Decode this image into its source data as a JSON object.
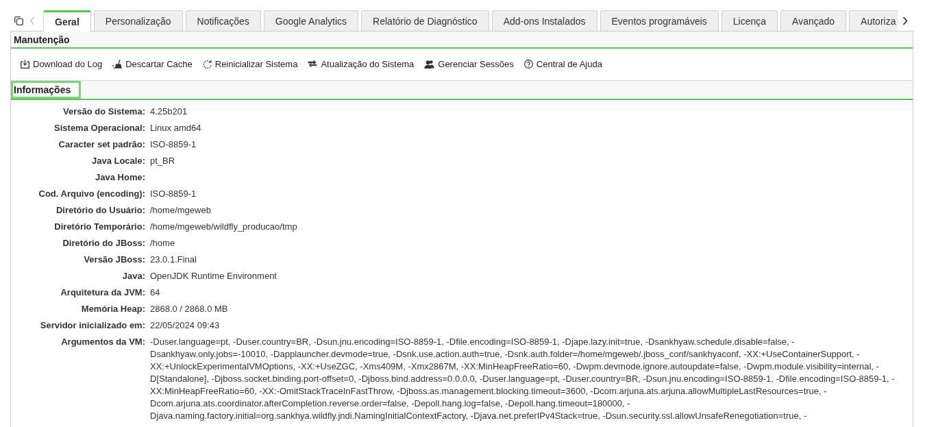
{
  "tab_scroll_buttons": [
    {
      "kind": "previous",
      "disabled": true
    },
    {
      "kind": "next",
      "disabled": false
    }
  ],
  "tabs": [
    {
      "label": "Geral",
      "selected": true
    },
    {
      "label": "Personalização",
      "selected": false
    },
    {
      "label": "Notificações",
      "selected": false
    },
    {
      "label": "Google Analytics",
      "selected": false
    },
    {
      "label": "Relatório de Diagnóstico",
      "selected": false
    },
    {
      "label": "Add-ons Instalados",
      "selected": false
    },
    {
      "label": "Eventos programáveis",
      "selected": false
    },
    {
      "label": "Licença",
      "selected": false
    },
    {
      "label": "Avançado",
      "selected": false
    },
    {
      "label": "Autoriza",
      "selected": false
    }
  ],
  "maintenance": {
    "title": "Manutenção",
    "focused": false,
    "actions": [
      {
        "kind": "download",
        "label": "Download do Log"
      },
      {
        "kind": "broom",
        "label": "Descartar Cache"
      },
      {
        "kind": "restart",
        "label": "Reinicializar Sistema"
      },
      {
        "kind": "swap",
        "label": "Atualização do Sistema"
      },
      {
        "kind": "people",
        "label": "Gerenciar Sessões"
      },
      {
        "kind": "help",
        "label": "Central de Ajuda"
      }
    ]
  },
  "information": {
    "title": "Informações",
    "focused": true,
    "rows": [
      {
        "label": "Versão do Sistema:",
        "value": "4.25b201"
      },
      {
        "label": "Sistema Operacional:",
        "value": "Linux amd64"
      },
      {
        "label": "Caracter set padrão:",
        "value": "ISO-8859-1"
      },
      {
        "label": "Java Locale:",
        "value": "pt_BR"
      },
      {
        "label": "Java Home:"
      },
      {
        "label": "Cod. Arquivo (encoding):",
        "value": "ISO-8859-1"
      },
      {
        "label": "Diretório do Usuário:",
        "value": "/home/mgeweb"
      },
      {
        "label": "Diretório Temporário:",
        "value": "/home/mgeweb/wildfly_producao/tmp"
      },
      {
        "label": "Diretório do JBoss:",
        "value": "/home"
      },
      {
        "label": "Versão JBoss:",
        "value": "23.0.1.Final"
      },
      {
        "label": "Java:",
        "value": "OpenJDK Runtime Environment"
      },
      {
        "label": "Arquitetura da JVM:",
        "value": "64"
      },
      {
        "label": "Memória Heap:",
        "value": "2868.0 / 2868.0 MB"
      },
      {
        "label": "Servidor inicializado em:",
        "value": "22/05/2024 09:43"
      },
      {
        "label": "Argumentos da VM:",
        "value": "-Duser.language=pt, -Duser.country=BR, -Dsun.jnu.encoding=ISO-8859-1, -Dfile.encoding=ISO-8859-1, -Djape.lazy.init=true, -Dsankhyaw.schedule.disable=false, -Dsankhyaw.only.jobs=-10010, -Dapplauncher.devmode=true, -Dsnk.use.action.auth=true, -Dsnk.auth.folder=/home/mgeweb/.jboss_conf/sankhyaconf, -XX:+UseContainerSupport, -XX:+UnlockExperimentalVMOptions, -XX:+UseZGC, -Xms409M, -Xmx2867M, -XX:MinHeapFreeRatio=60, -Dwpm.devmode.ignore.autoupdate=false, -Dwpm.module.visibility=internal, -D[Standalone], -Djboss.socket.binding.port-offset=0, -Djboss.bind.address=0.0.0.0, -Duser.language=pt, -Duser.country=BR, -Dsun.jnu.encoding=ISO-8859-1, -Dfile.encoding=ISO-8859-1, -XX:MinHeapFreeRatio=60, -XX:-OmitStackTraceInFastThrow, -Djboss.as.management.blocking.timeout=3600, -Dcom.arjuna.ats.arjuna.allowMultipleLastResources=true, -Dcom.arjuna.ats.coordinator.afterCompletion.reverse.order=false, -Depoll.hang.log=false, -Depoll.hang.timeout=180000, -Djava.naming.factory.initial=org.sankhya.wildfly.jndi.NamingInitialContextFactory, -Djava.net.preferIPv4Stack=true, -Dsun.security.ssl.allowUnsafeRenegotiation=true, -"
      }
    ]
  }
}
